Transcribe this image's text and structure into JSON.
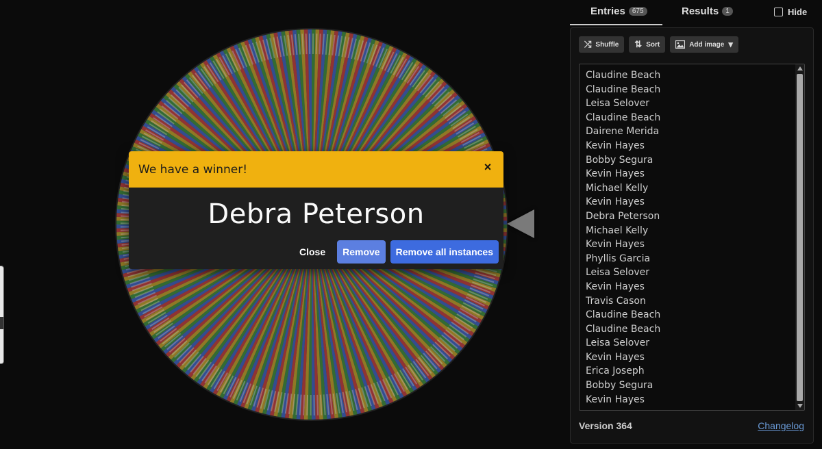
{
  "dialog": {
    "title": "We have a winner!",
    "close_x": "×",
    "winner": "Debra Peterson",
    "close_label": "Close",
    "remove_label": "Remove",
    "remove_all_label": "Remove all instances"
  },
  "tabs": {
    "entries_label": "Entries",
    "entries_count": "675",
    "results_label": "Results",
    "results_count": "1",
    "hide_label": "Hide"
  },
  "toolbar": {
    "shuffle_label": "Shuffle",
    "sort_label": "Sort",
    "add_image_label": "Add image"
  },
  "entries": [
    "Claudine Beach",
    "Claudine Beach",
    "Leisa Selover",
    "Claudine Beach",
    "Dairene Merida",
    "Kevin Hayes",
    "Bobby Segura",
    "Kevin Hayes",
    "Michael Kelly",
    "Kevin Hayes",
    "Debra Peterson",
    "Michael Kelly",
    "Kevin Hayes",
    "Phyllis Garcia",
    "Leisa Selover",
    "Kevin Hayes",
    "Travis Cason",
    "Claudine Beach",
    "Claudine Beach",
    "Leisa Selover",
    "Kevin Hayes",
    "Erica Joseph",
    "Bobby Segura",
    "Kevin Hayes"
  ],
  "footer": {
    "version": "Version 364",
    "changelog": "Changelog"
  },
  "wheel": {
    "segment_colors": [
      "#3a8f3a",
      "#c8a424",
      "#c83a3a",
      "#3a62c8"
    ]
  },
  "icons": {
    "shuffle": "shuffle-icon",
    "sort": "sort-icon",
    "add_image": "image-icon",
    "dropdown": "chevron-down-icon",
    "pointer": "pointer-arrow-icon"
  }
}
